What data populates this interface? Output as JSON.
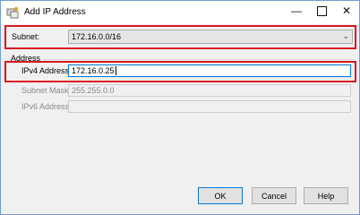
{
  "window": {
    "title": "Add IP Address"
  },
  "subnet": {
    "label": "Subnet:",
    "value": "172.16.0.0/16"
  },
  "address_group": {
    "title": "Address",
    "ipv4": {
      "label": "IPv4 Address:",
      "value": "172.16.0.25"
    },
    "mask": {
      "label": "Subnet Mask",
      "value": "255.255.0.0"
    },
    "ipv6": {
      "label": "IPv6 Address",
      "value": ""
    }
  },
  "buttons": {
    "ok": "OK",
    "cancel": "Cancel",
    "help": "Help"
  },
  "colors": {
    "highlight": "#d81820",
    "focus": "#0078d7"
  }
}
